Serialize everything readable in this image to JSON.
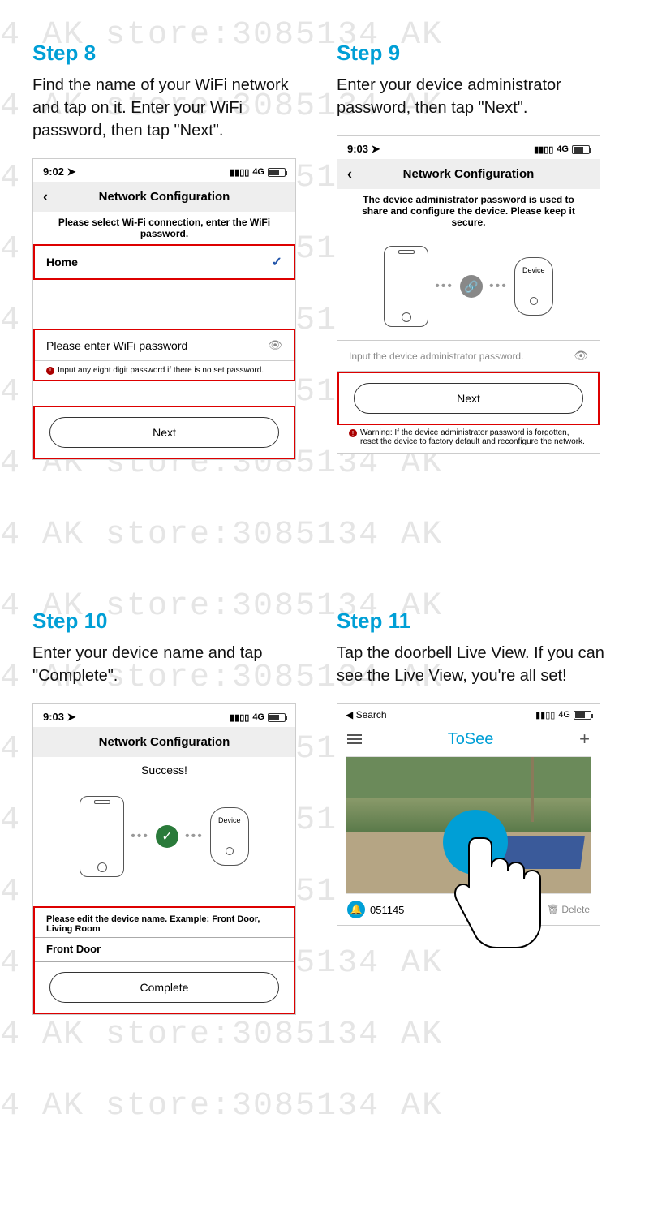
{
  "watermark_text": "4 AK store:3085134 AK",
  "step8": {
    "title": "Step 8",
    "desc": "Find the name of your WiFi network and tap on it. Enter your WiFi password, then tap \"Next\".",
    "time": "9:02",
    "signal": "4G",
    "nav_title": "Network Configuration",
    "subtext": "Please select Wi-Fi connection, enter the WiFi password.",
    "wifi_name": "Home",
    "pw_placeholder": "Please enter WiFi password",
    "hint": "Input any eight digit password if there is no set password.",
    "next": "Next"
  },
  "step9": {
    "title": "Step 9",
    "desc": "Enter your device administrator password, then tap \"Next\".",
    "time": "9:03",
    "signal": "4G",
    "nav_title": "Network Configuration",
    "subtext": "The device administrator password is used to share and configure the device. Please keep it secure.",
    "device_label": "Device",
    "pw_placeholder": "Input the device administrator password.",
    "next": "Next",
    "warning": "Warning: If the device administrator password is forgotten, reset the device to factory default and reconfigure the network."
  },
  "step10": {
    "title": "Step 10",
    "desc": "Enter your device name and tap \"Complete\".",
    "time": "9:03",
    "signal": "4G",
    "nav_title": "Network Configuration",
    "success": "Success!",
    "device_label": "Device",
    "edit_label": "Please edit the device name. Example: Front Door, Living Room",
    "device_name": "Front Door",
    "complete": "Complete"
  },
  "step11": {
    "title": "Step 11",
    "desc": "Tap the doorbell Live View. If you can see the Live View, you're all set!",
    "search": "Search",
    "signal": "4G",
    "app_title": "ToSee",
    "device_id": "051145",
    "delete": "Delete"
  }
}
